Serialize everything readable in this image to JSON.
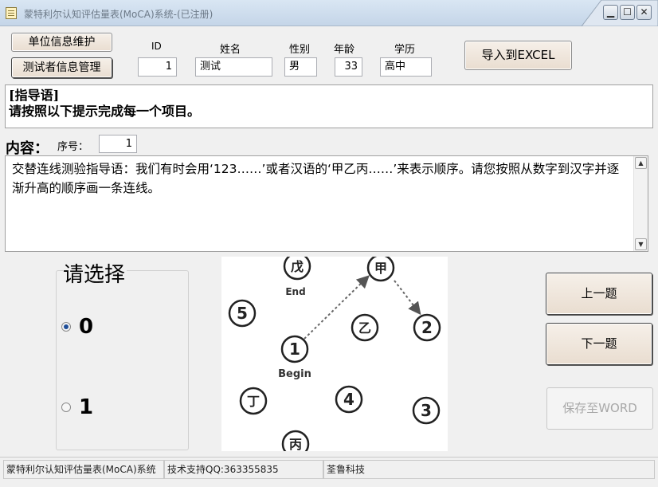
{
  "window": {
    "title": "蒙特利尔认知评估量表(MoCA)系统-(已注册)",
    "min_glyph": "▁",
    "max_glyph": "☐",
    "close_glyph": "✕"
  },
  "header": {
    "unit_info_button": "单位信息维护",
    "tester_info_button": "测试者信息管理",
    "export_excel_button": "导入到EXCEL",
    "id_label": "ID",
    "id_value": "1",
    "name_label": "姓名",
    "name_value": "测试",
    "gender_label": "性别",
    "gender_value": "男",
    "age_label": "年龄",
    "age_value": "33",
    "education_label": "学历",
    "education_value": "高中"
  },
  "guide": {
    "heading": "[指导语]",
    "text": "请按照以下提示完成每一个项目。"
  },
  "content": {
    "label": "内容：",
    "seq_label": "序号：",
    "seq_value": "1",
    "text": "交替连线测验指导语：我们有时会用‘123……’或者汉语的‘甲乙丙……’来表示顺序。请您按照从数字到汉字并逐渐升高的顺序画一条连线。"
  },
  "choice": {
    "title": "请选择",
    "options": [
      {
        "label": "0",
        "checked": true
      },
      {
        "label": "1",
        "checked": false
      }
    ]
  },
  "figure": {
    "nodes": {
      "wu": "戊",
      "jia": "甲",
      "five": "5",
      "yi": "乙",
      "two": "2",
      "one": "1",
      "ding": "丁",
      "four": "4",
      "three": "3",
      "bing": "丙"
    },
    "end_label": "End",
    "begin_label": "Begin"
  },
  "nav": {
    "prev_button": "上一题",
    "next_button": "下一题",
    "save_word_button": "保存至WORD"
  },
  "status": {
    "app_name": "蒙特利尔认知评估量表(MoCA)系统",
    "support": "技术支持QQ:363355835",
    "company": "荃鲁科技"
  },
  "colors": {
    "radio_checked": "#1f4e98",
    "disabled_text": "#a8a8a8"
  }
}
